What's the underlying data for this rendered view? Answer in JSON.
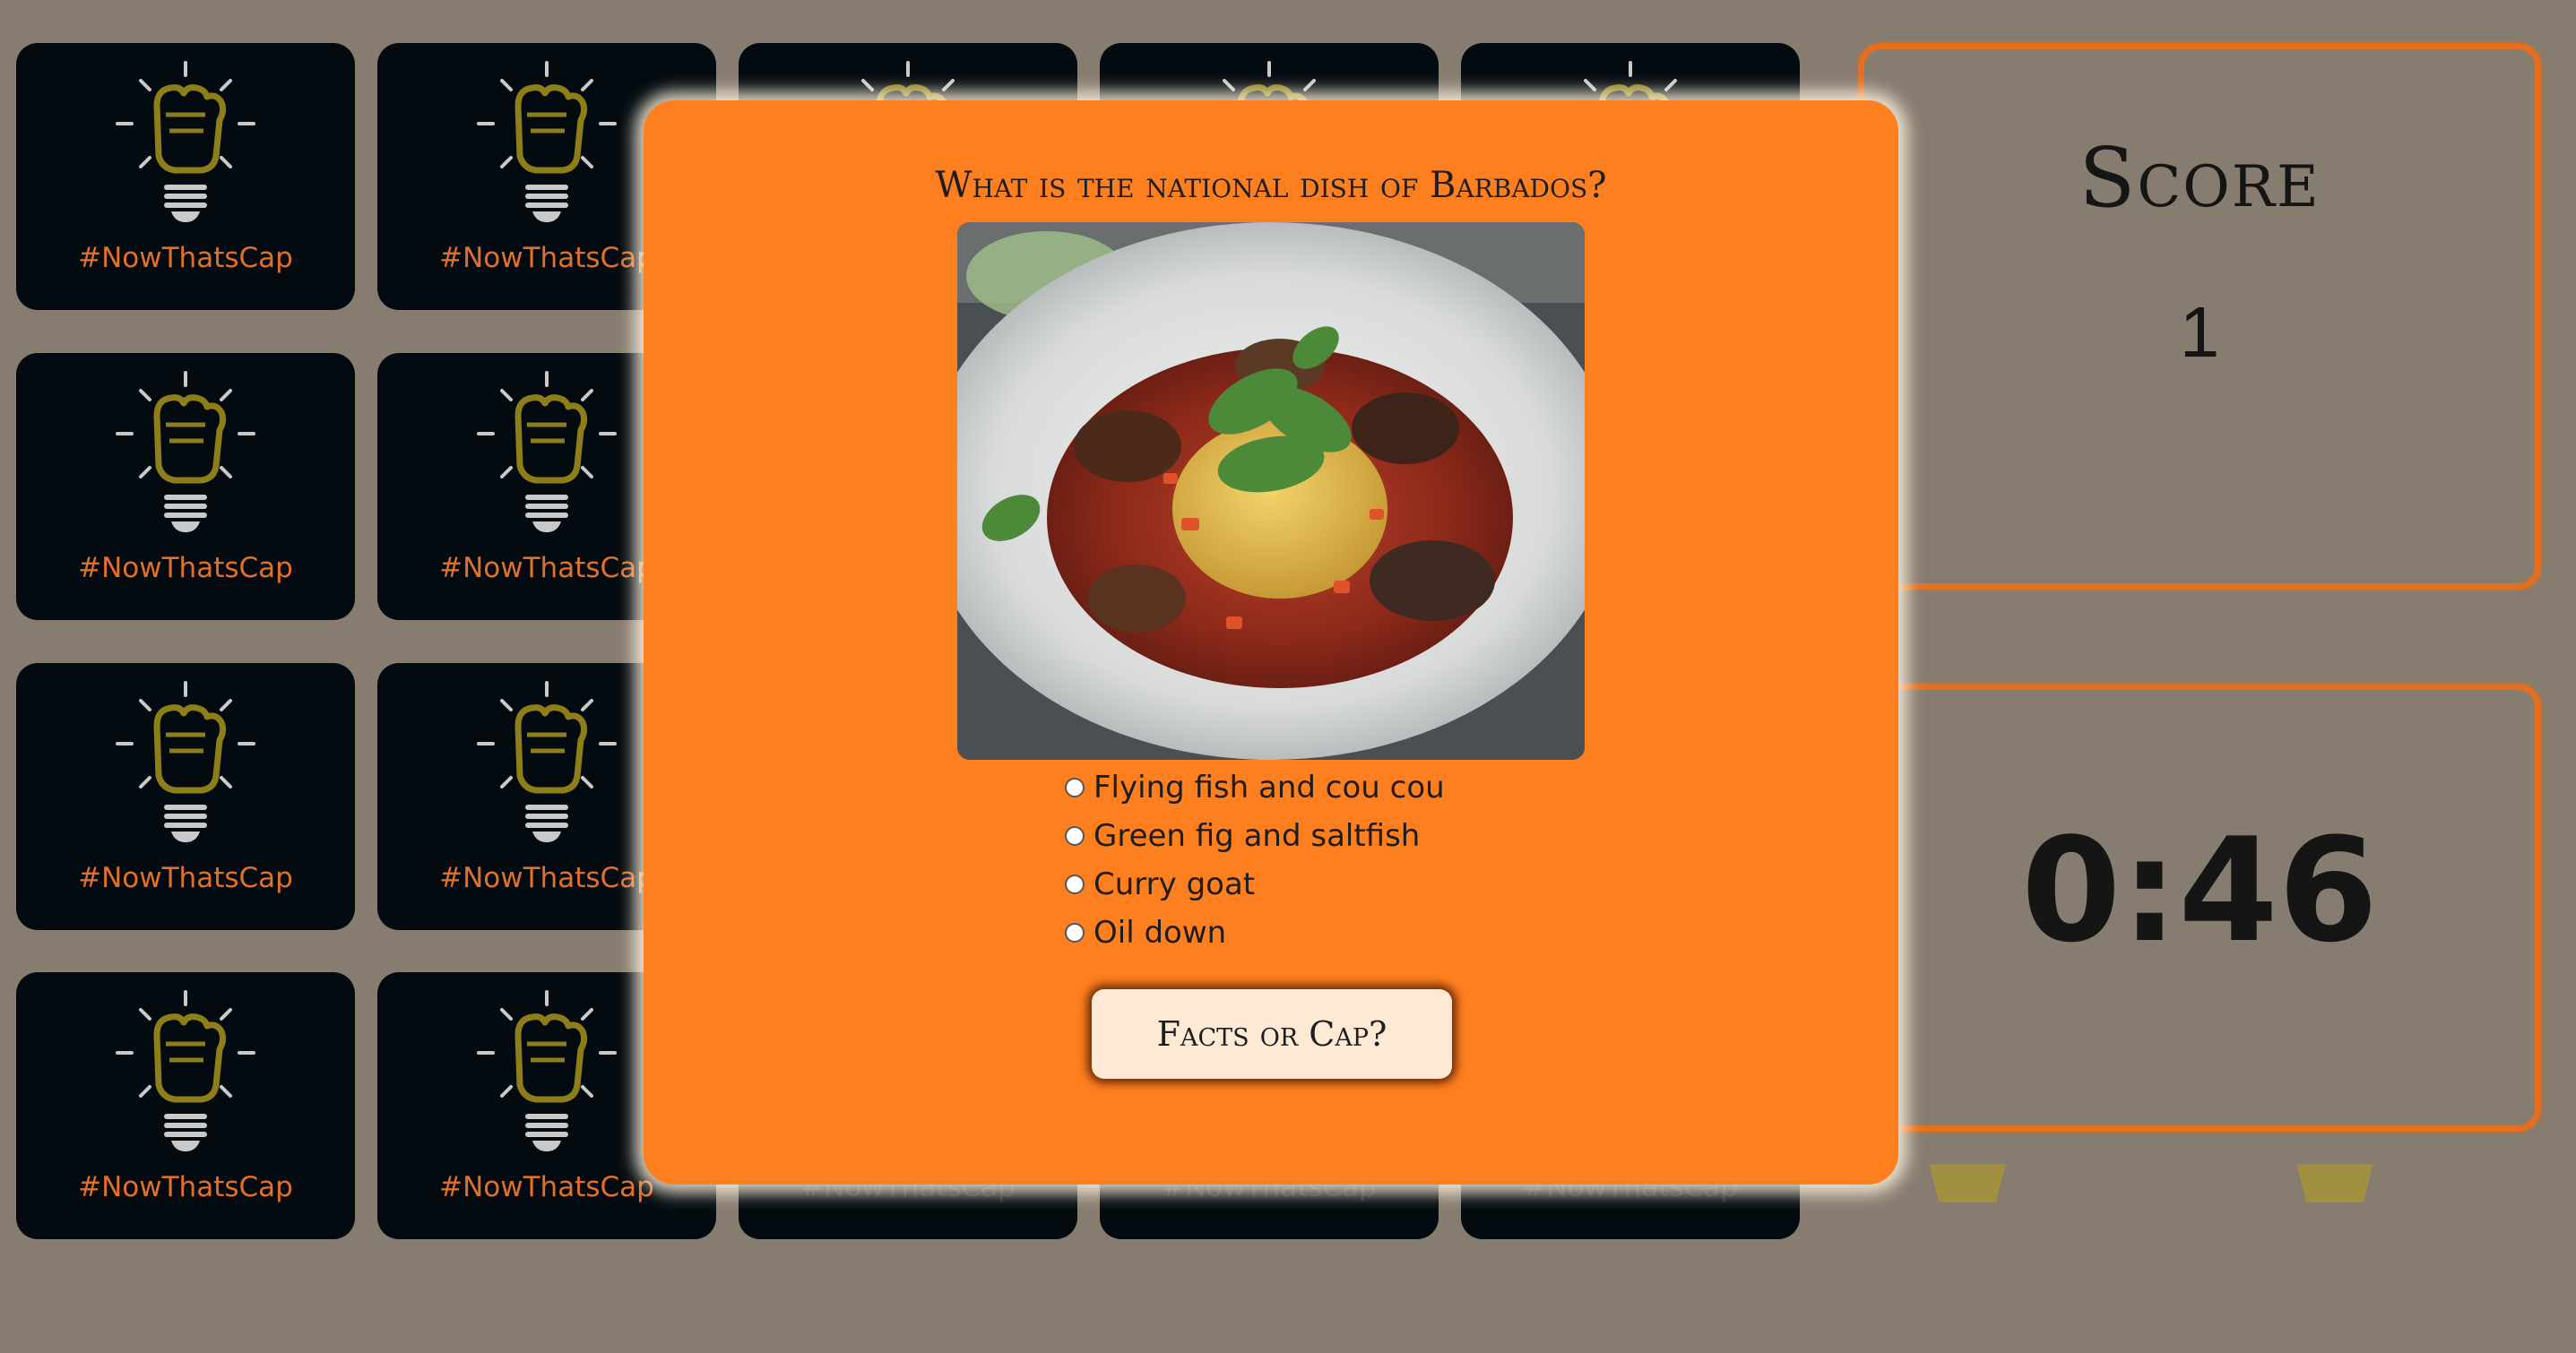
{
  "game": {
    "card_tag": "#NowThatsCap",
    "card_count": 20
  },
  "score_panel": {
    "title": "Score",
    "value": "1"
  },
  "timer_panel": {
    "value": "0:46"
  },
  "modal": {
    "question": "What is the national dish of Barbados?",
    "image_alt": "Plate of flying fish and cou cou",
    "options": [
      {
        "label": "Flying fish and cou cou",
        "checked": false
      },
      {
        "label": "Green fig and saltfish",
        "checked": false
      },
      {
        "label": "Curry goat",
        "checked": false
      },
      {
        "label": "Oil down",
        "checked": false
      }
    ],
    "submit_label": "Facts or Cap?"
  },
  "colors": {
    "background": "#877c70",
    "card": "#040b10",
    "accent": "#fe7f1f",
    "tag": "#e0702a",
    "bulb": "#8e7e1a",
    "button": "#feead4"
  }
}
